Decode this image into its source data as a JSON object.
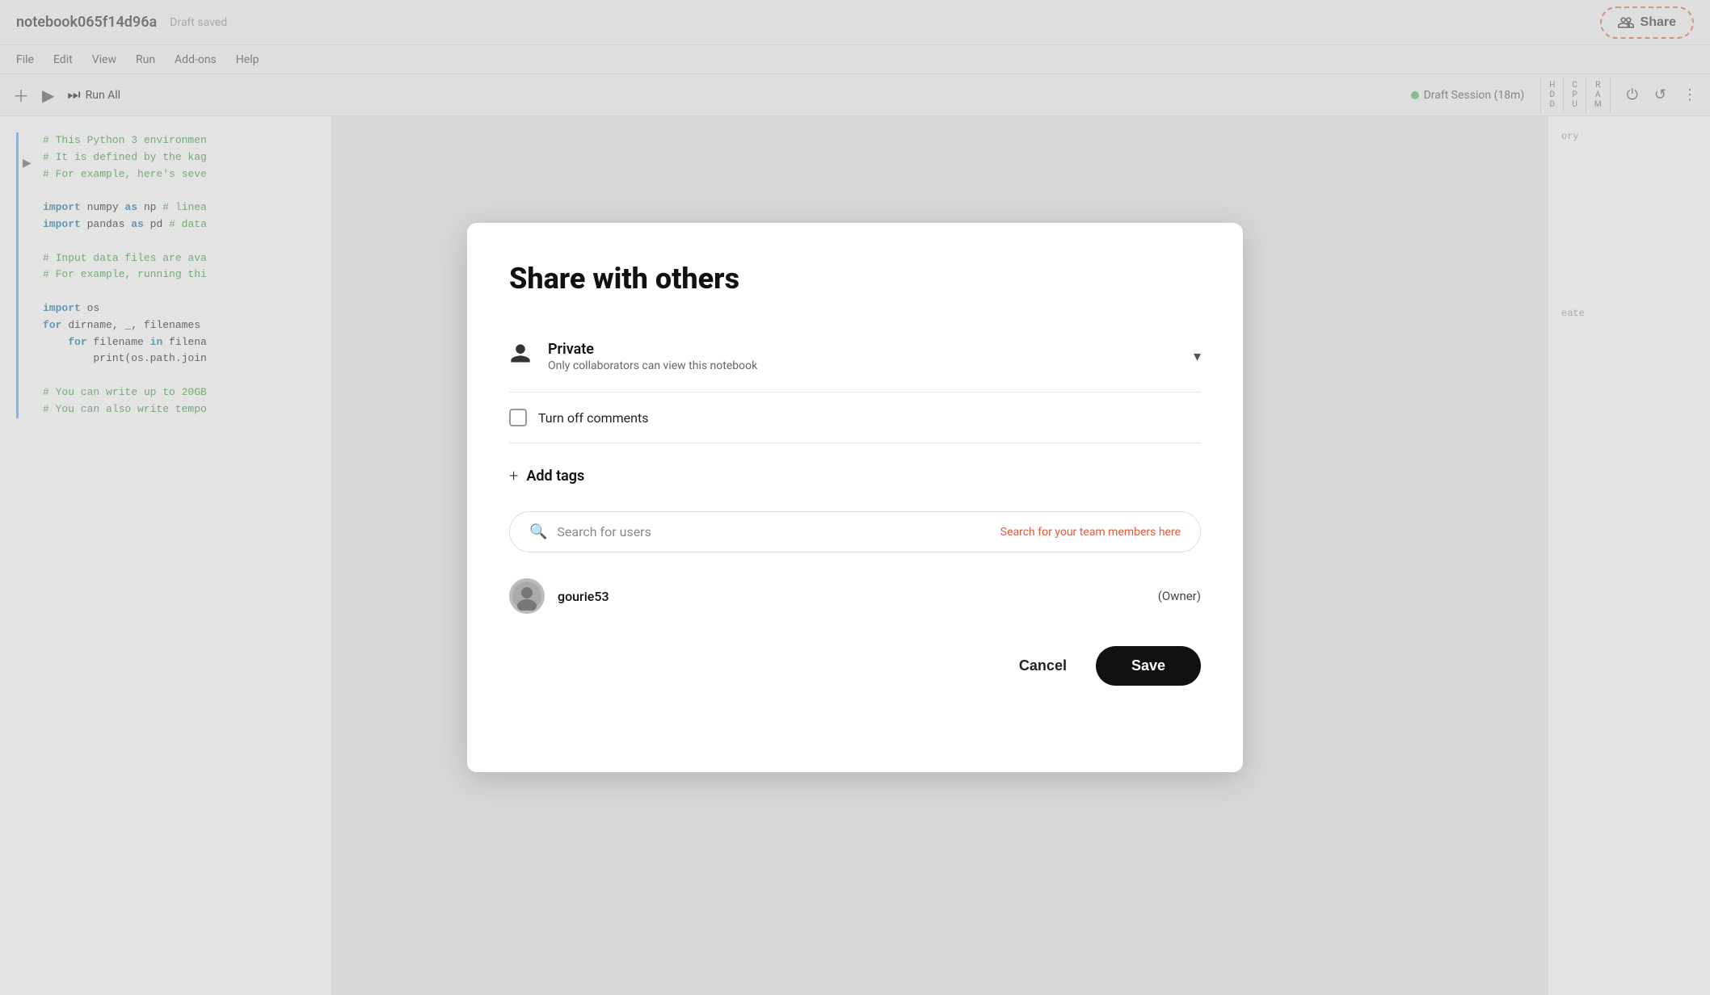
{
  "topbar": {
    "notebook_title": "notebook065f14d96a",
    "draft_status": "Draft saved",
    "share_label": "Share"
  },
  "menubar": {
    "items": [
      "File",
      "Edit",
      "View",
      "Run",
      "Add-ons",
      "Help"
    ]
  },
  "toolbar": {
    "run_all_label": "Run All",
    "session_label": "Draft Session (18m)",
    "hdd_label": "H\nD\nD",
    "cpu_label": "C\nP\nU",
    "ram_label": "R\nA\nM"
  },
  "modal": {
    "title": "Share with others",
    "privacy": {
      "label": "Private",
      "sublabel": "Only collaborators can view this notebook"
    },
    "checkbox": {
      "label": "Turn off comments"
    },
    "add_tags": {
      "label": "Add tags"
    },
    "search": {
      "placeholder": "Search for users",
      "hint": "Search for your team members here"
    },
    "user": {
      "name": "gourie53",
      "role": "(Owner)"
    },
    "cancel_label": "Cancel",
    "save_label": "Save"
  }
}
